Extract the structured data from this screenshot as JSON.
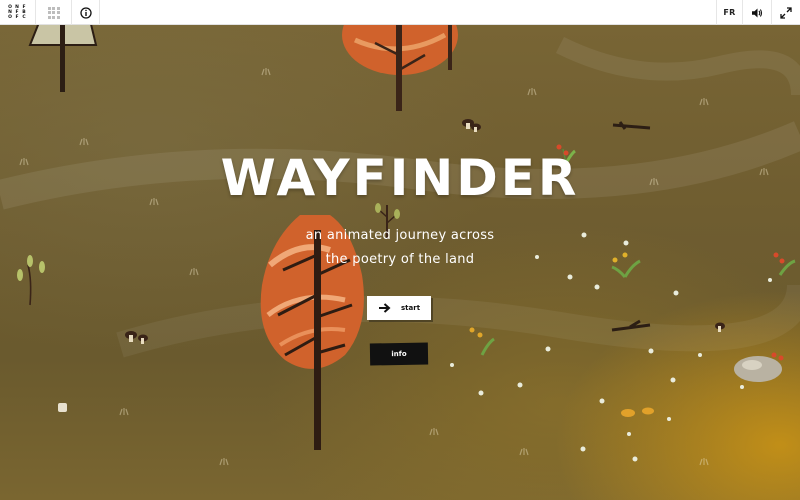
{
  "topbar": {
    "logo_letters": [
      "O",
      "N",
      "F",
      "N",
      "F",
      "B",
      "O",
      "F",
      "C"
    ],
    "grid_icon": "grid-dots-icon",
    "info_icon": "info-icon",
    "language_label": "FR",
    "sound_icon": "speaker-icon",
    "fullscreen_icon": "expand-icon"
  },
  "hero": {
    "title": "WAYFINDER",
    "subtitle_line1": "an animated journey across",
    "subtitle_line2": "the poetry of the land",
    "start_label": "start",
    "start_icon": "arrow-right-icon",
    "info_label": "info"
  },
  "colors": {
    "background": "#6f5d30",
    "tree_orange": "#d0622c",
    "trunk": "#3a2418",
    "button_white": "#ffffff",
    "button_black": "#111111"
  }
}
